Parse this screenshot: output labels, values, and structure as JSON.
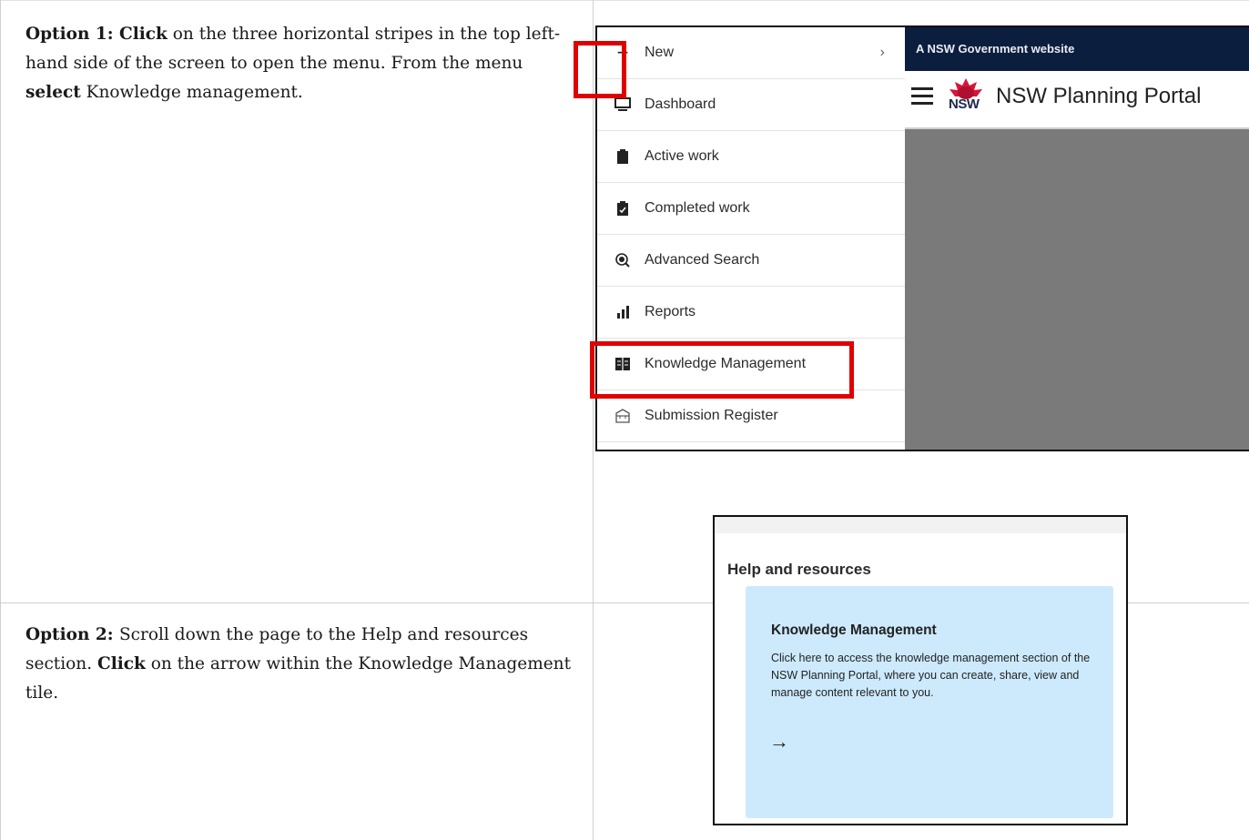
{
  "rows": [
    {
      "parts": [
        {
          "text": "Option 1: ",
          "bold": true
        },
        {
          "text": "Click",
          "bold": true
        },
        {
          "text": " on the three horizontal stripes in the top left-hand side of the screen to open the menu. From the menu ",
          "bold": false
        },
        {
          "text": "select",
          "bold": true
        },
        {
          "text": " Knowledge management.",
          "bold": false
        }
      ]
    },
    {
      "parts": [
        {
          "text": "Option 2: ",
          "bold": true
        },
        {
          "text": "Scroll down the page to the Help and resources section. ",
          "bold": false
        },
        {
          "text": "Click",
          "bold": true
        },
        {
          "text": " on the arrow within the Knowledge Management tile.",
          "bold": false
        }
      ]
    }
  ],
  "screenshot1": {
    "gov_banner": "A NSW Government website",
    "portal_title": "NSW Planning Portal",
    "logo_text": "NSW",
    "menu": [
      {
        "label": "New",
        "icon": "plus-icon",
        "glyph": "+",
        "chevron": "›"
      },
      {
        "label": "Dashboard",
        "icon": "monitor-icon",
        "glyph": "🖵"
      },
      {
        "label": "Active work",
        "icon": "clipboard-icon",
        "glyph": "▮"
      },
      {
        "label": "Completed work",
        "icon": "clipboard-check-icon",
        "glyph": "▮"
      },
      {
        "label": "Advanced Search",
        "icon": "search-icon",
        "glyph": "◉"
      },
      {
        "label": "Reports",
        "icon": "bar-chart-icon",
        "glyph": "ıl"
      },
      {
        "label": "Knowledge Management",
        "icon": "book-icon",
        "glyph": "▤"
      },
      {
        "label": "Submission Register",
        "icon": "inbox-icon",
        "glyph": "⌸"
      }
    ]
  },
  "screenshot2": {
    "section_title": "Help and resources",
    "tile_title": "Knowledge Management",
    "tile_description": "Click here to access the knowledge management section of the NSW Planning Portal, where you can create, share, view and manage content relevant to you.",
    "tile_arrow": "→"
  }
}
